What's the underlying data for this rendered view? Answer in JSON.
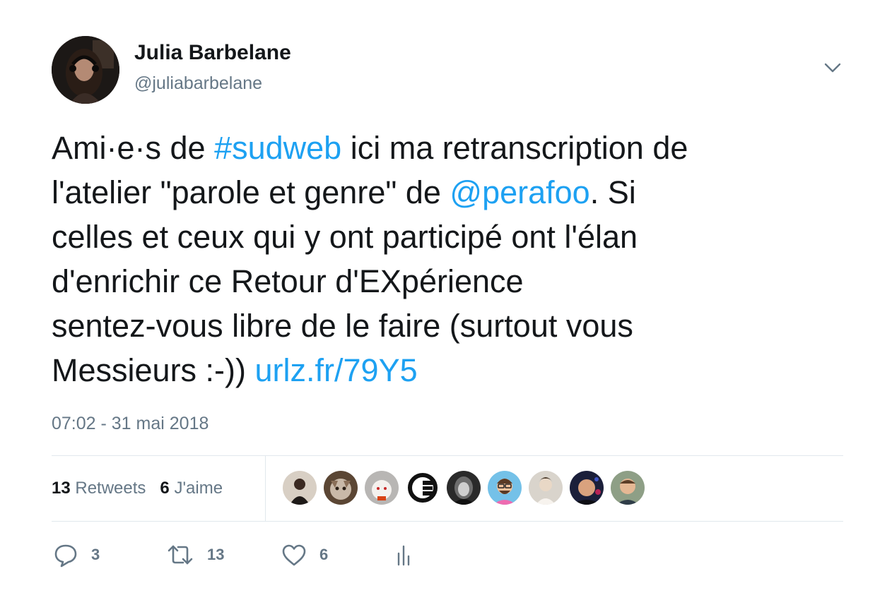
{
  "author": {
    "display_name": "Julia Barbelane",
    "handle": "@juliabarbelane"
  },
  "tweet": {
    "lines": [
      [
        {
          "text": "Ami·e·s de ",
          "link": false
        },
        {
          "text": "#sudweb",
          "link": true
        },
        {
          "text": " ici ma retranscription de",
          "link": false
        }
      ],
      [
        {
          "text": "l'atelier \"parole et genre\" de ",
          "link": false
        },
        {
          "text": "@perafoo",
          "link": true
        },
        {
          "text": ". Si",
          "link": false
        }
      ],
      [
        {
          "text": "celles et ceux qui y ont participé ont l'élan",
          "link": false
        }
      ],
      [
        {
          "text": "d'enrichir ce Retour d'EXpérience",
          "link": false
        }
      ],
      [
        {
          "text": "sentez-vous libre de le faire (surtout vous",
          "link": false
        }
      ],
      [
        {
          "text": "Messieurs :-)) ",
          "link": false
        },
        {
          "text": "urlz.fr/79Y5",
          "link": true
        }
      ]
    ],
    "timestamp": "07:02 - 31 mai 2018"
  },
  "stats": {
    "retweets_count": "13",
    "retweets_label": "Retweets",
    "likes_count": "6",
    "likes_label": "J'aime"
  },
  "actions": {
    "reply_count": "3",
    "retweet_count": "13",
    "like_count": "6"
  },
  "icons": {
    "caret": "chevron-down-icon",
    "reply": "reply-icon",
    "retweet": "retweet-icon",
    "like": "heart-icon",
    "analytics": "analytics-icon"
  },
  "colors": {
    "link": "#1da1f2",
    "text": "#14171a",
    "secondary": "#657786",
    "divider": "#e1e8ed"
  }
}
